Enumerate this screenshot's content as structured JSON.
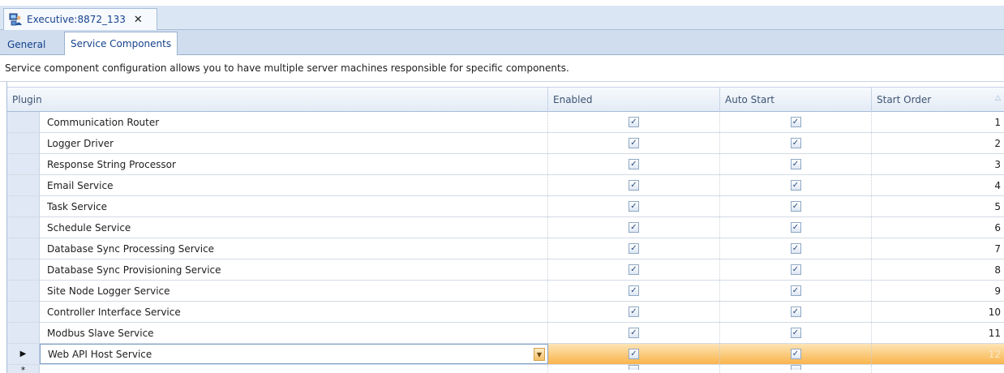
{
  "document_tab": {
    "title": "Executive:8872_133",
    "close_glyph": "✕"
  },
  "page_tabs": [
    {
      "label": "General"
    },
    {
      "label": "Service Components"
    }
  ],
  "description": "Service component configuration allows you to have multiple server machines responsible for specific components.",
  "grid": {
    "columns": {
      "plugin": "Plugin",
      "enabled": "Enabled",
      "auto_start": "Auto Start",
      "start_order": "Start Order"
    },
    "rows": [
      {
        "name": "Communication Router",
        "enabled": true,
        "auto_start": true,
        "order": "1"
      },
      {
        "name": "Logger Driver",
        "enabled": true,
        "auto_start": true,
        "order": "2"
      },
      {
        "name": "Response String Processor",
        "enabled": true,
        "auto_start": true,
        "order": "3"
      },
      {
        "name": "Email Service",
        "enabled": true,
        "auto_start": true,
        "order": "4"
      },
      {
        "name": "Task Service",
        "enabled": true,
        "auto_start": true,
        "order": "5"
      },
      {
        "name": "Schedule Service",
        "enabled": true,
        "auto_start": true,
        "order": "6"
      },
      {
        "name": "Database Sync Processing Service",
        "enabled": true,
        "auto_start": true,
        "order": "7"
      },
      {
        "name": "Database Sync Provisioning Service",
        "enabled": true,
        "auto_start": true,
        "order": "8"
      },
      {
        "name": "Site Node Logger Service",
        "enabled": true,
        "auto_start": true,
        "order": "9"
      },
      {
        "name": "Controller Interface Service",
        "enabled": true,
        "auto_start": true,
        "order": "10"
      },
      {
        "name": "Modbus Slave Service",
        "enabled": true,
        "auto_start": true,
        "order": "11"
      },
      {
        "name": "Web API Host Service",
        "enabled": true,
        "auto_start": true,
        "order": "12",
        "active": true
      }
    ],
    "current_row_glyph": "▶",
    "new_row_glyph": "*",
    "check_glyph": "✓",
    "dropdown_glyph": "▼",
    "sort_glyph": "△"
  },
  "colors": {
    "header_blue": "#dbe6f4",
    "active_row_orange": "#f9b44b",
    "tab_text": "#15428b"
  },
  "icons": {
    "app": "executive-app-icon",
    "close": "close-icon",
    "checkbox": "checkbox-checked-icon",
    "dropdown": "chevron-down-icon",
    "sort": "sort-asc-icon"
  }
}
